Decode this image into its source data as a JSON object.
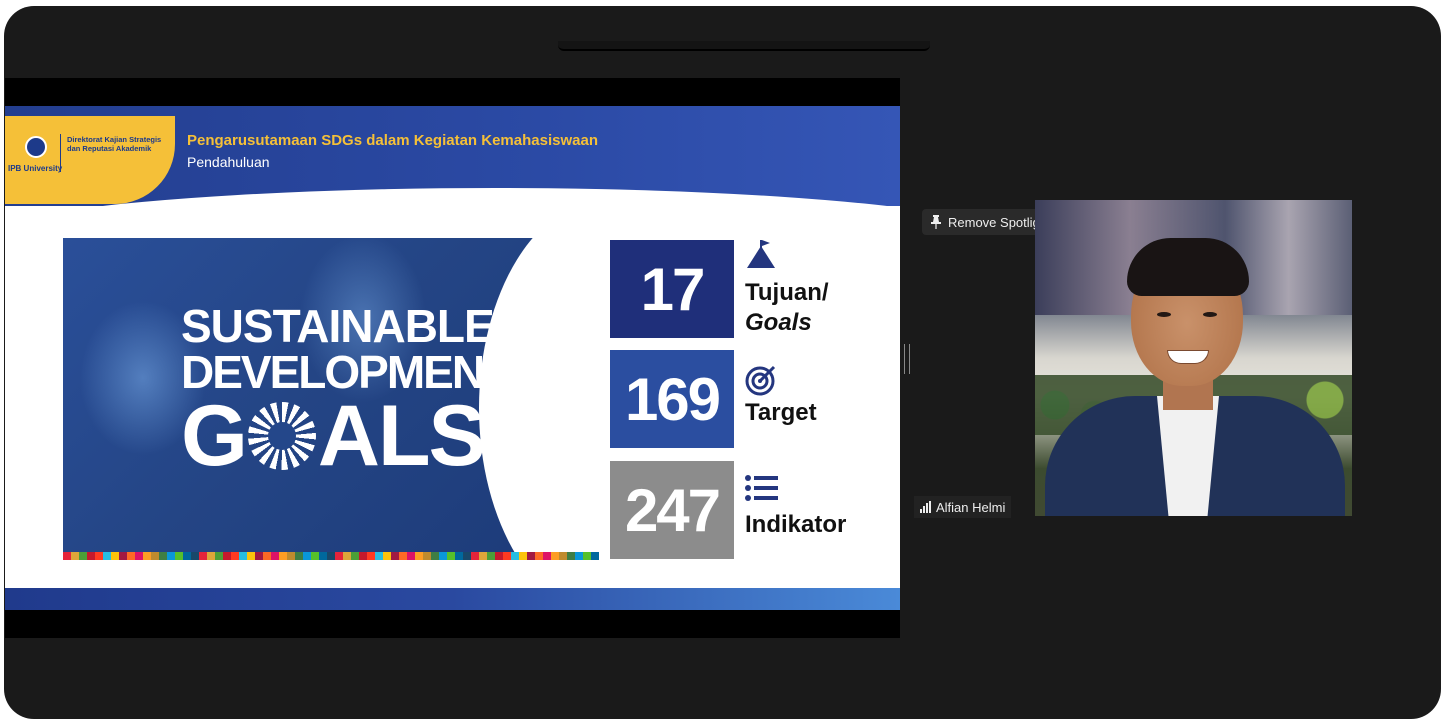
{
  "slide": {
    "logo_university": "IPB University",
    "logo_directorate": "Direktorat Kajian Strategis dan Reputasi Akademik",
    "title": "Pengarusutamaan SDGs dalam Kegiatan Kemahasiswaan",
    "subtitle": "Pendahuluan",
    "sdg_line1": "SUSTAINABLE",
    "sdg_line2": "DEVELOPMENT",
    "sdg_line3_a": "G",
    "sdg_line3_b": "ALS",
    "stats": [
      {
        "number": "17",
        "label_line1": "Tujuan/",
        "label_line2": "Goals",
        "icon": "mountain-flag-icon",
        "color": "#1f2f7a"
      },
      {
        "number": "169",
        "label_line1": "Target",
        "icon": "target-icon",
        "color": "#2b4ea0"
      },
      {
        "number": "247",
        "label_line1": "Indikator",
        "icon": "list-icon",
        "color": "#8c8c8c"
      }
    ]
  },
  "spotlight": {
    "label": "Remove Spotlight",
    "icon": "pin-icon"
  },
  "participant": {
    "name": "Alfian Helmi",
    "icon": "signal-strength-icon"
  }
}
